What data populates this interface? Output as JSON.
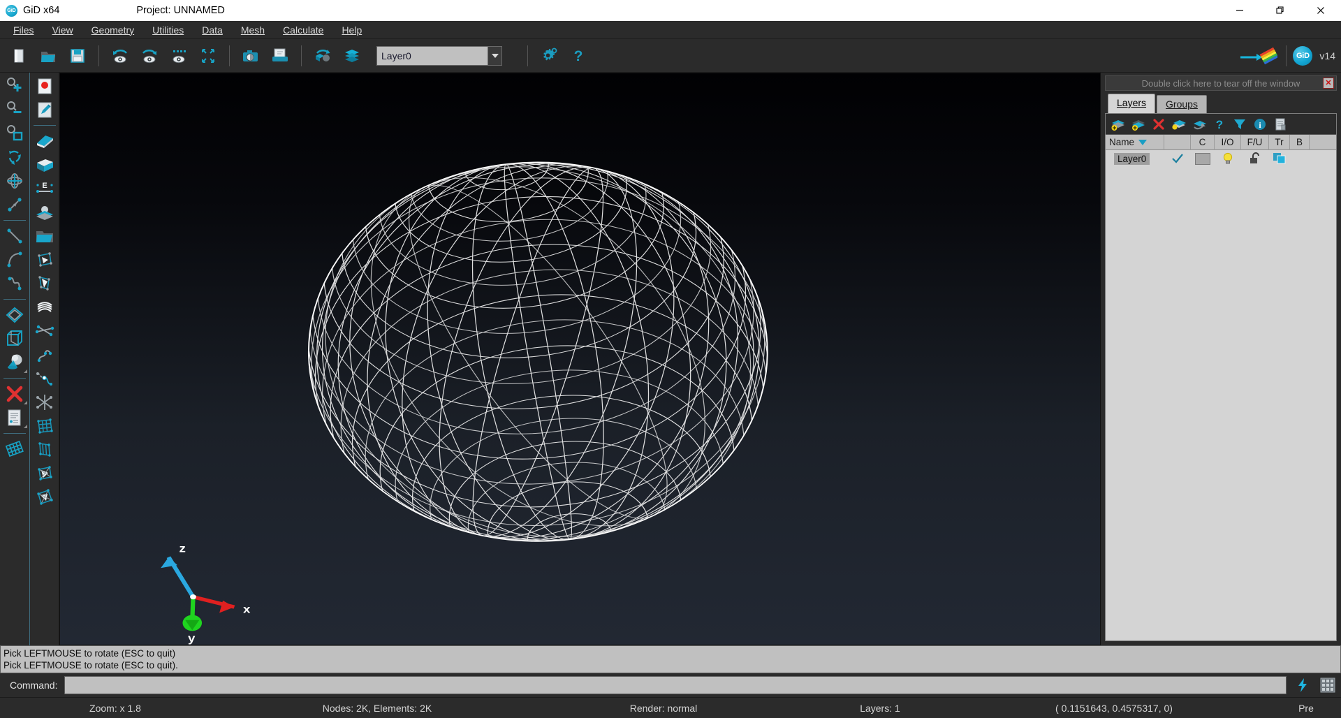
{
  "titlebar": {
    "logo_icon": "gid-logo-icon",
    "app_title": "GiD x64",
    "project_title": "Project: UNNAMED",
    "minimize_label": "—",
    "maximize_label": "❐",
    "close_label": "✕"
  },
  "menubar": {
    "items": [
      {
        "label": "Files",
        "accel": "F"
      },
      {
        "label": "View",
        "accel": "V"
      },
      {
        "label": "Geometry",
        "accel": "G"
      },
      {
        "label": "Utilities",
        "accel": "U"
      },
      {
        "label": "Data",
        "accel": "D"
      },
      {
        "label": "Mesh",
        "accel": "M"
      },
      {
        "label": "Calculate",
        "accel": "C"
      },
      {
        "label": "Help",
        "accel": "H"
      }
    ]
  },
  "toolbar": {
    "buttons": [
      {
        "name": "new-project-icon",
        "tip": "New"
      },
      {
        "name": "open-project-icon",
        "tip": "Open"
      },
      {
        "name": "save-project-icon",
        "tip": "Save"
      },
      {
        "name": "undo-view-icon",
        "tip": "Previous view"
      },
      {
        "name": "redo-view-icon",
        "tip": "Next view"
      },
      {
        "name": "render-view-icon",
        "tip": "Redraw"
      },
      {
        "name": "zoom-frame-icon",
        "tip": "Zoom frame"
      },
      {
        "name": "print-to-image-icon",
        "tip": "Print to image"
      },
      {
        "name": "print-icon",
        "tip": "Print"
      },
      {
        "name": "rotate-object-icon",
        "tip": "Rotate"
      },
      {
        "name": "layers-icon",
        "tip": "Layers"
      }
    ],
    "layer_combo_value": "Layer0",
    "settings_icon": "gear-settings-icon",
    "help_icon": "question-help-icon",
    "postprocess_icon": "arrow-colorbar-icon",
    "gid_badge_label": "GiD",
    "version_label": "v14"
  },
  "left_sidebar": {
    "column1": [
      {
        "name": "zoom-in-icon"
      },
      {
        "name": "zoom-out-icon"
      },
      {
        "name": "zoom-frame-icon"
      },
      {
        "name": "rotate-recycle-icon"
      },
      {
        "name": "rotate-trackball-icon"
      },
      {
        "name": "pan-arrows-icon"
      },
      {
        "sep": true
      },
      {
        "name": "create-line-icon"
      },
      {
        "name": "create-arc-icon"
      },
      {
        "name": "create-nurbs-curve-icon"
      },
      {
        "sep": true
      },
      {
        "name": "create-surface-icon"
      },
      {
        "name": "create-volume-icon"
      },
      {
        "name": "create-object-icon",
        "more": true
      },
      {
        "sep": true
      },
      {
        "name": "delete-icon",
        "more": true
      },
      {
        "name": "list-entities-icon",
        "more": true
      },
      {
        "sep": true
      },
      {
        "name": "mesh-quality-icon"
      }
    ],
    "column2": [
      {
        "name": "point-create-icon"
      },
      {
        "name": "edit-point-icon"
      },
      {
        "sep": true
      },
      {
        "name": "surface-nurbs-icon"
      },
      {
        "name": "volume-box-icon"
      },
      {
        "name": "contact-entity-icon"
      },
      {
        "name": "mesh-surface-icon"
      },
      {
        "name": "open-layer-icon"
      },
      {
        "name": "rotate-element-icon"
      },
      {
        "name": "scale-element-icon"
      },
      {
        "name": "sweep-surface-icon"
      },
      {
        "name": "intersect-lines-icon"
      },
      {
        "name": "nurbs-line-icon"
      },
      {
        "name": "split-curve-icon"
      },
      {
        "name": "join-lines-icon"
      },
      {
        "name": "structured-mesh-icon"
      },
      {
        "name": "unstructured-mesh-icon"
      },
      {
        "name": "mesh-volume-icon"
      },
      {
        "name": "mesh-criteria-icon"
      }
    ]
  },
  "viewport": {
    "background_top": "#010103",
    "background_bottom": "#222833",
    "mesh_color": "#f2f2f2",
    "object": "sphere-wireframe-mesh",
    "axes": {
      "x_label": "x",
      "y_label": "y",
      "z_label": "z",
      "x_color": "#e02020",
      "y_color": "#1fd41f",
      "z_color": "#2aa8e0"
    }
  },
  "right_panel": {
    "tearoff_hint": "Double click here to tear off the window",
    "close_label": "✕",
    "tabs": [
      {
        "label": "Layers",
        "accel": "L",
        "active": true
      },
      {
        "label": "Groups",
        "accel": "G",
        "active": false
      }
    ],
    "layer_toolbar": [
      {
        "name": "new-layer-icon"
      },
      {
        "name": "new-layer-alt-icon"
      },
      {
        "name": "delete-layer-icon"
      },
      {
        "name": "send-to-layer-icon"
      },
      {
        "name": "layer-properties-icon"
      },
      {
        "name": "layer-help-icon"
      },
      {
        "name": "filter-layers-icon"
      },
      {
        "name": "layer-info-icon"
      },
      {
        "name": "layer-report-icon"
      }
    ],
    "columns": [
      {
        "key": "name",
        "label": "Name",
        "sort_icon": "sort-descending-icon"
      },
      {
        "key": "c",
        "label": "C"
      },
      {
        "key": "io",
        "label": "I/O"
      },
      {
        "key": "fu",
        "label": "F/U"
      },
      {
        "key": "tr",
        "label": "Tr"
      },
      {
        "key": "b",
        "label": "B"
      }
    ],
    "rows": [
      {
        "name": "Layer0",
        "visible_icon": "checkmark-icon",
        "color_swatch": "#a8a8a8",
        "io_icon": "lightbulb-on-icon",
        "fu_icon": "unlocked-padlock-icon",
        "tr_icon": "transparency-squares-icon",
        "b_icon": ""
      }
    ]
  },
  "messages": {
    "lines": [
      "Pick LEFTMOUSE to rotate (ESC to quit)",
      "Pick LEFTMOUSE to rotate (ESC to quit)."
    ]
  },
  "command": {
    "label": "Command:",
    "value": "",
    "placeholder": "",
    "fast_icon": "lightning-bolt-icon",
    "grid_icon": "grid-snap-icon"
  },
  "statusbar": {
    "zoom": "Zoom: x 1.8",
    "mesh_info": "Nodes: 2K, Elements: 2K",
    "render": "Render: normal",
    "layers": "Layers: 1",
    "coordinates": "( 0.1151643, 0.4575317, 0)",
    "mode": "Pre"
  },
  "chart_data": null
}
